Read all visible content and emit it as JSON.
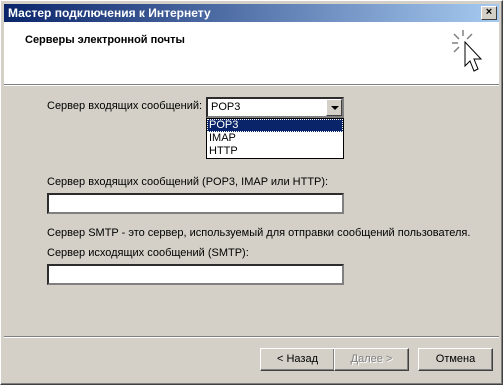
{
  "window": {
    "title": "Мастер подключения к Интернету",
    "close_glyph": "×"
  },
  "header": {
    "title": "Серверы электронной почты",
    "icon": "wizard-sparkle-cursor-icon"
  },
  "form": {
    "incoming_type_label": "Сервер входящих сообщений:",
    "incoming_type_value": "POP3",
    "incoming_type_options": [
      "POP3",
      "IMAP",
      "HTTP"
    ],
    "incoming_server_label": "Сервер входящих сообщений (POP3, IMAP или HTTP):",
    "incoming_server_value": "",
    "smtp_note": "Сервер SMTP - это сервер, используемый для отправки сообщений  пользователя.",
    "smtp_label": "Сервер исходящих сообщений (SMTP):",
    "smtp_value": ""
  },
  "buttons": {
    "back": "< Назад",
    "next": "Далее >",
    "cancel": "Отмена"
  },
  "colors": {
    "titlebar_start": "#0a246a",
    "titlebar_end": "#a6caf0",
    "face": "#d4d0c8",
    "selection": "#0a246a"
  }
}
